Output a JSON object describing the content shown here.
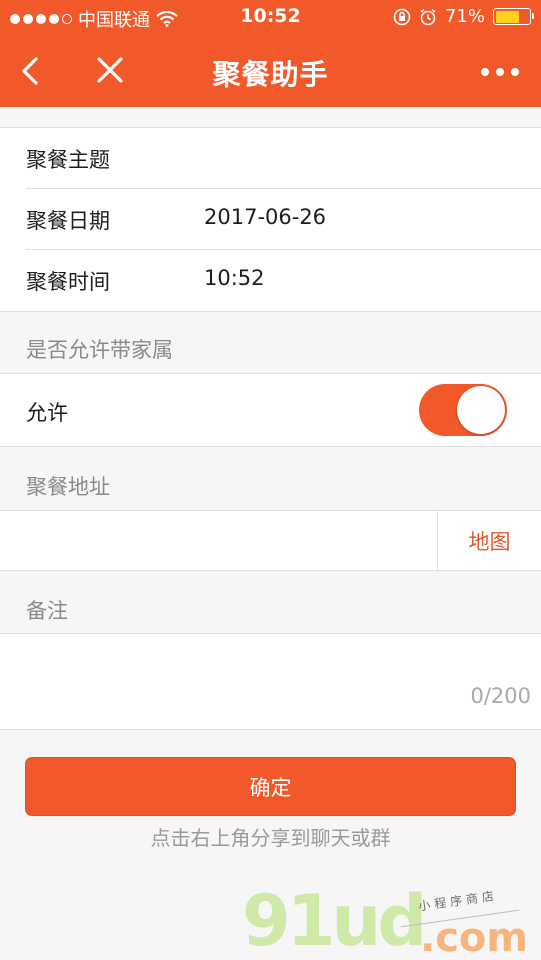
{
  "status_bar": {
    "carrier": "中国联通",
    "time": "10:52",
    "battery": "71%",
    "battery_level": 0.71,
    "battery_color": "#ffd21f"
  },
  "navbar": {
    "title": "聚餐助手",
    "color": "#f1582a"
  },
  "form": {
    "topic_label": "聚餐主题",
    "topic_value": "",
    "date_label": "聚餐日期",
    "date_value": "2017-06-26",
    "time_label": "聚餐时间",
    "time_value": "10:52",
    "family_group_title": "是否允许带家属",
    "allow_label": "允许",
    "allow_enabled": true,
    "address_group_title": "聚餐地址",
    "address_value": "",
    "map_button": "地图",
    "note_group_title": "备注",
    "note_value": "",
    "note_counter": "0/200"
  },
  "actions": {
    "confirm_label": "确定",
    "share_hint": "点击右上角分享到聊天或群"
  },
  "watermark": {
    "main": "91ud",
    "domain": ".com",
    "sub": "小程序商店"
  }
}
